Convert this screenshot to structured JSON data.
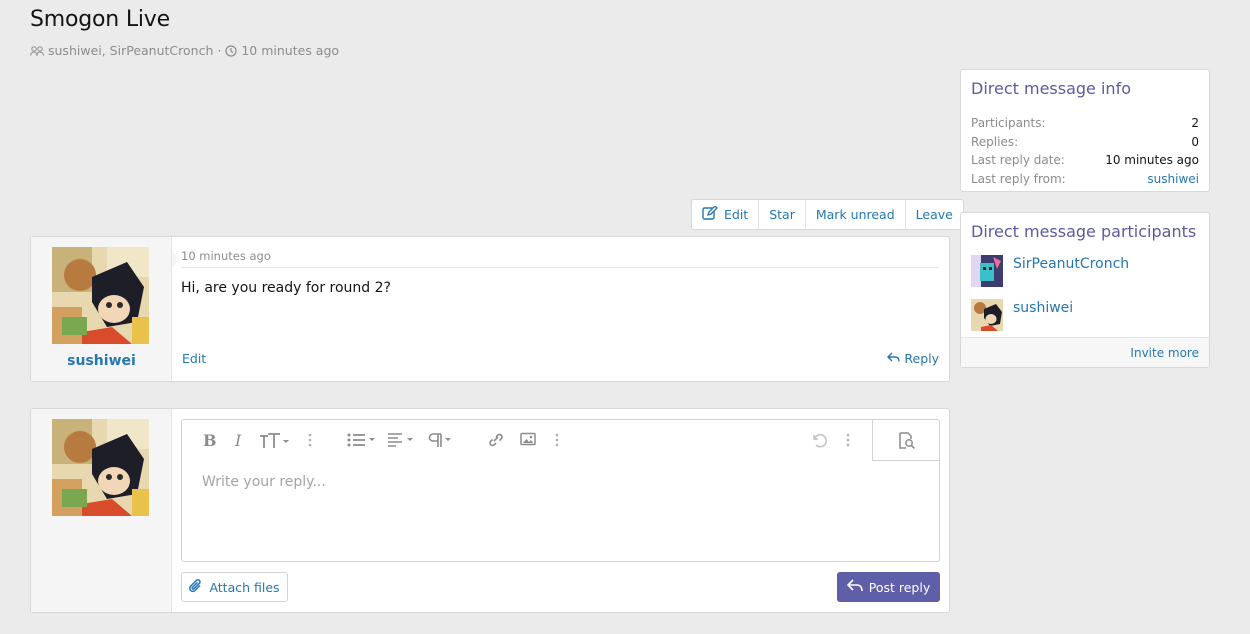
{
  "page": {
    "title": "Smogon Live",
    "participants_text": "sushiwei, SirPeanutCronch",
    "separator": "·",
    "time": "10 minutes ago"
  },
  "actions": {
    "edit": "Edit",
    "star": "Star",
    "mark_unread": "Mark unread",
    "leave": "Leave"
  },
  "message": {
    "author": "sushiwei",
    "time": "10 minutes ago",
    "body": "Hi, are you ready for round 2?",
    "edit_label": "Edit",
    "reply_label": "Reply"
  },
  "editor": {
    "placeholder": "Write your reply...",
    "attach_label": "Attach files",
    "post_label": "Post reply"
  },
  "info": {
    "title": "Direct message info",
    "rows": [
      {
        "label": "Participants:",
        "value": "2"
      },
      {
        "label": "Replies:",
        "value": "0"
      },
      {
        "label": "Last reply date:",
        "value": "10 minutes ago"
      },
      {
        "label": "Last reply from:",
        "value": "sushiwei"
      }
    ]
  },
  "participants": {
    "title": "Direct message participants",
    "items": [
      {
        "name": "SirPeanutCronch"
      },
      {
        "name": "sushiwei"
      }
    ],
    "invite_label": "Invite more"
  },
  "colors": {
    "accent": "#5e5ea9",
    "link": "#2577b1",
    "background": "#ebebeb"
  }
}
